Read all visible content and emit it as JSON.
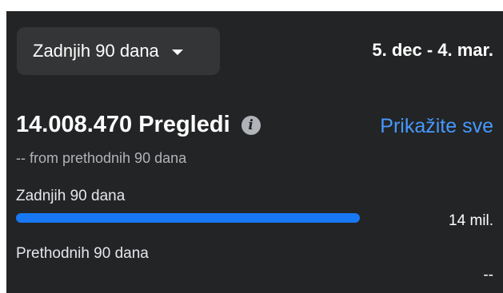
{
  "filter": {
    "period_label": "Zadnjih 90 dana",
    "date_range": "5. dec - 4. mar."
  },
  "metric": {
    "value_label": "14.008.470 Pregledi",
    "see_all": "Prikažite sve",
    "comparison": "-- from prethodnih 90 dana"
  },
  "bars": [
    {
      "label": "Zadnjih 90 dana",
      "value_text": "14 mil.",
      "fill_fraction": 1.0,
      "color": "#1877f2"
    },
    {
      "label": "Prethodnih 90 dana",
      "value_text": "--",
      "fill_fraction": 0.0,
      "color": "#1877f2"
    }
  ],
  "icons": {
    "dropdown": "caret-down-icon",
    "info": "info-icon"
  }
}
